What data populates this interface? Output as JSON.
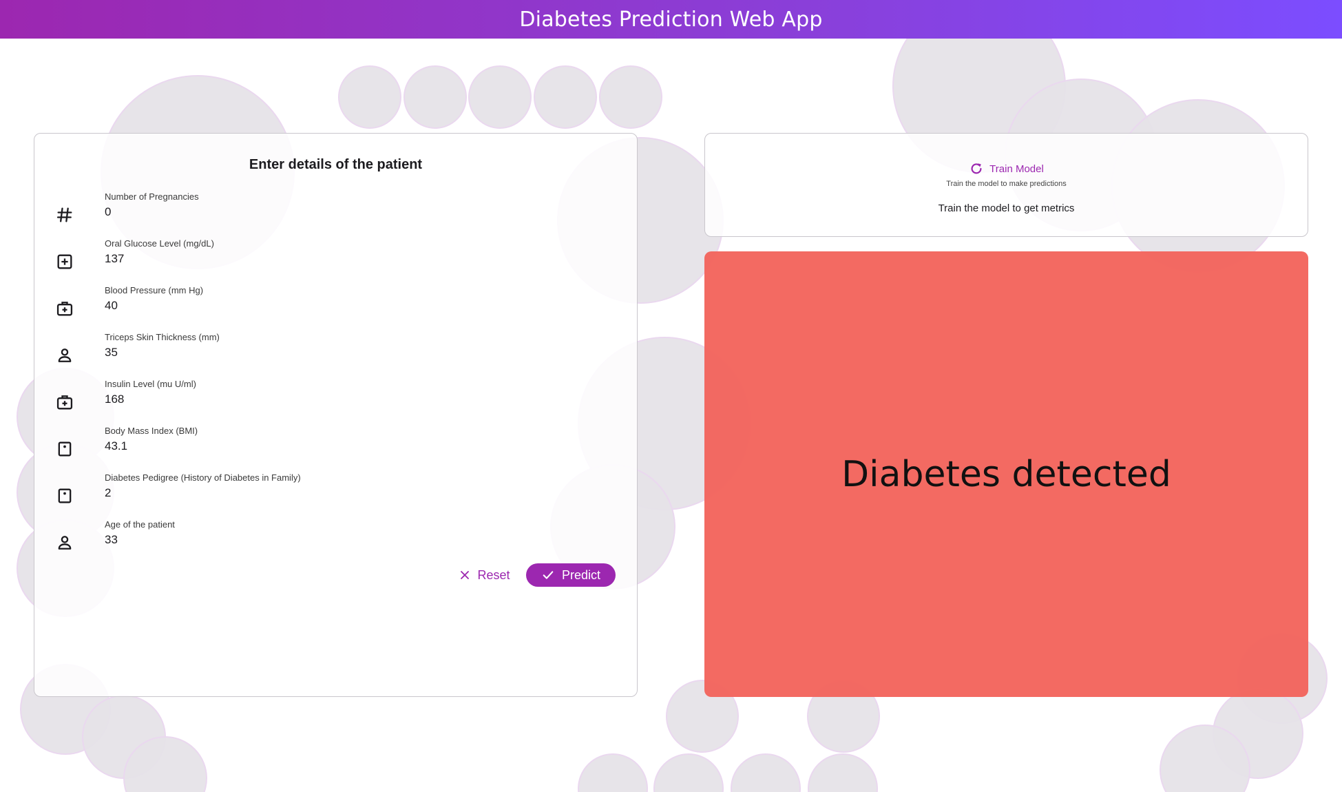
{
  "app": {
    "title": "Diabetes Prediction Web App"
  },
  "form": {
    "title": "Enter details of the patient",
    "fields": [
      {
        "label": "Number of Pregnancies",
        "value": "0",
        "icon": "hash-icon"
      },
      {
        "label": "Oral Glucose Level (mg/dL)",
        "value": "137",
        "icon": "plus-box-icon"
      },
      {
        "label": "Blood Pressure (mm Hg)",
        "value": "40",
        "icon": "medical-bag-icon"
      },
      {
        "label": "Triceps Skin Thickness (mm)",
        "value": "35",
        "icon": "person-icon"
      },
      {
        "label": "Insulin Level (mu U/ml)",
        "value": "168",
        "icon": "medical-bag-icon"
      },
      {
        "label": "Body Mass Index (BMI)",
        "value": "43.1",
        "icon": "scale-icon"
      },
      {
        "label": "Diabetes Pedigree (History of Diabetes in Family)",
        "value": "2",
        "icon": "scale-icon"
      },
      {
        "label": "Age of the patient",
        "value": "33",
        "icon": "person-icon"
      }
    ],
    "reset_label": "Reset",
    "predict_label": "Predict"
  },
  "train": {
    "button_label": "Train Model",
    "subtitle": "Train the model to make predictions",
    "metrics_text": "Train the model to get metrics"
  },
  "result": {
    "text": "Diabetes detected",
    "color": "#f2645c"
  },
  "colors": {
    "accent": "#9c27b0",
    "header_gradient_start": "#9c27b0",
    "header_gradient_end": "#7c4dff",
    "bubble": "#e6e3e8"
  }
}
